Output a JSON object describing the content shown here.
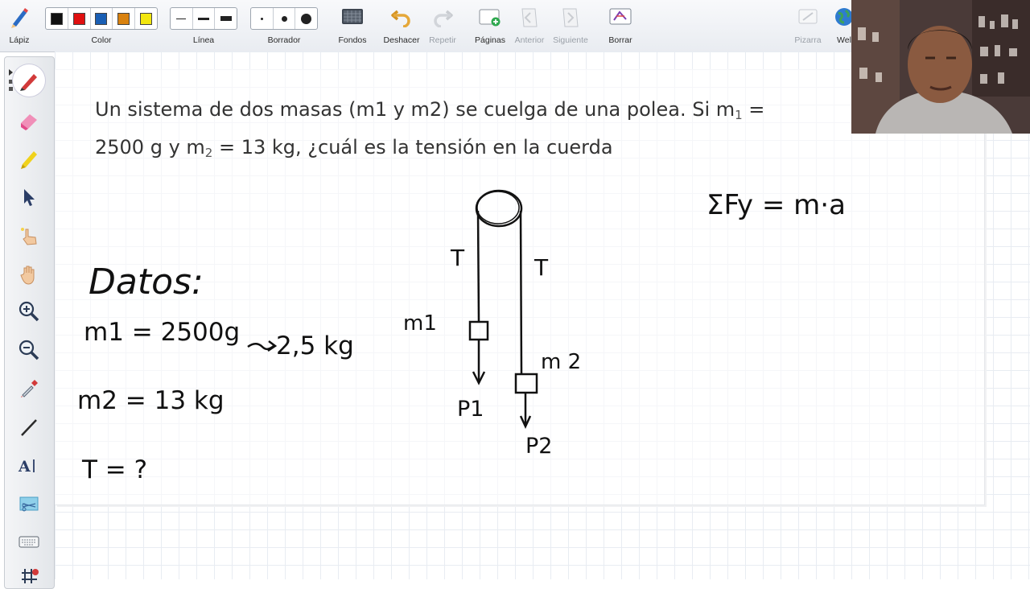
{
  "toolbar": {
    "pencil": "Lápiz",
    "color": "Color",
    "line": "Línea",
    "eraser": "Borrador",
    "backgrounds": "Fondos",
    "undo": "Deshacer",
    "redo": "Repetir",
    "pages": "Páginas",
    "previous": "Anterior",
    "next": "Siguiente",
    "clear": "Borrar",
    "whiteboard": "Pizarra",
    "web": "Wel",
    "colors": [
      "#111111",
      "#e01010",
      "#1a5fb4",
      "#d9820f",
      "#f2e60f"
    ]
  },
  "problem": {
    "line1": "Un sistema de dos masas (m1 y m2) se cuelga de una polea. Si m",
    "sub_1": "1",
    "line1_end": " =",
    "line2_a": "2500 g y m",
    "sub_2": "2",
    "line2_b": " = 13 kg, ¿cuál es la tensión en la cuerda"
  },
  "handwriting": {
    "datos": "Datos:",
    "m1": "m1 = 2500g",
    "m1_conv": "2,5 kg",
    "m2": "m2 = 13 kg",
    "t": "T = ?",
    "diagram_t_left": "T",
    "diagram_t_right": "T",
    "diagram_m1": "m1",
    "diagram_m2": "m 2",
    "p1": "P1",
    "p2": "P2",
    "equation": "ΣFy = m·a"
  }
}
